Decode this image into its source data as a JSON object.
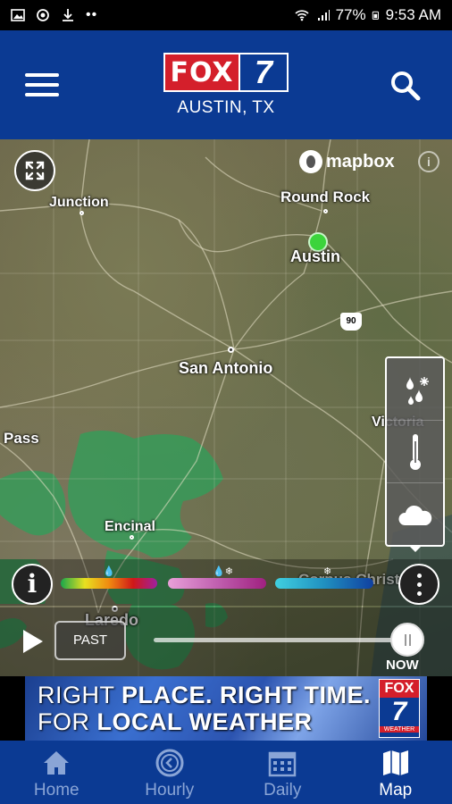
{
  "status_bar": {
    "battery": "77%",
    "time": "9:53 AM"
  },
  "header": {
    "logo_fox": "FOX",
    "logo_seven": "7",
    "location": "AUSTIN, TX"
  },
  "map": {
    "attribution": "mapbox",
    "cities": [
      {
        "name": "Junction"
      },
      {
        "name": "Round Rock"
      },
      {
        "name": "Austin"
      },
      {
        "name": "San Antonio"
      },
      {
        "name": "Victoria"
      },
      {
        "name": "Pass"
      },
      {
        "name": "Encinal"
      },
      {
        "name": "Corpus Christi"
      },
      {
        "name": "Laredo"
      }
    ],
    "highway_shield": "90"
  },
  "layers": [
    {
      "name": "precip-type",
      "icon": "rain-snow-icon"
    },
    {
      "name": "temperature",
      "icon": "thermometer-icon"
    },
    {
      "name": "clouds",
      "icon": "cloud-icon"
    }
  ],
  "legend": {
    "info_label": "i",
    "scales": [
      {
        "type": "rain",
        "colors": [
          "#1aa84b",
          "#e8e020",
          "#f08a10",
          "#d01818",
          "#a020a0"
        ]
      },
      {
        "type": "mix",
        "colors": [
          "#e8a0d8",
          "#c060b0",
          "#a02080"
        ]
      },
      {
        "type": "snow",
        "colors": [
          "#40d0e0",
          "#2090c0",
          "#1040a0"
        ]
      }
    ]
  },
  "timeline": {
    "past_label": "PAST",
    "now_label": "NOW",
    "progress": 1.0
  },
  "ad": {
    "line1_a": "RIGHT ",
    "line1_b": "PLACE. RIGHT TIME.",
    "line2_a": "FOR ",
    "line2_b": "LOCAL WEATHER",
    "logo_fox": "FOX",
    "logo_seven": "7",
    "logo_sub": "WEATHER"
  },
  "nav": {
    "items": [
      {
        "label": "Home",
        "icon": "home-icon",
        "active": false
      },
      {
        "label": "Hourly",
        "icon": "clock-icon",
        "active": false
      },
      {
        "label": "Daily",
        "icon": "calendar-icon",
        "active": false
      },
      {
        "label": "Map",
        "icon": "map-icon",
        "active": true
      }
    ]
  },
  "colors": {
    "brand_blue": "#0b3a93",
    "fox_red": "#d41f2b",
    "location_dot": "#3cd43c",
    "radar_green": "#2fa05a"
  }
}
